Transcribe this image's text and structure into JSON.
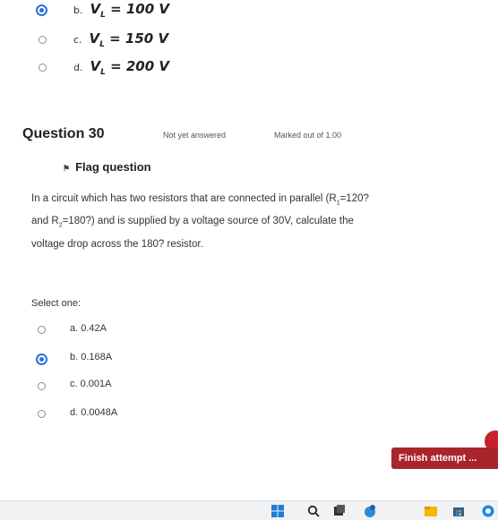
{
  "previous_question": {
    "options": [
      {
        "letter": "b.",
        "var": "V",
        "sub": "L",
        "rest": " = 100 V",
        "selected": true
      },
      {
        "letter": "c.",
        "var": "V",
        "sub": "L",
        "rest": " = 150 V",
        "selected": false
      },
      {
        "letter": "d.",
        "var": "V",
        "sub": "L",
        "rest": " = 200 V",
        "selected": false
      }
    ]
  },
  "question": {
    "title": "Question 30",
    "status": "Not yet answered",
    "marked": "Marked out of 1.00",
    "flag_label": "Flag question",
    "text_line1": "In a circuit which has two resistors that are connected in parallel (R",
    "text_line1_sub": "1",
    "text_line1_end": "=120?",
    "text_line2": "and R",
    "text_line2_sub": "2",
    "text_line2_end": "=180?) and is supplied by a voltage source of 30V, calculate the",
    "text_line3": "voltage drop across the 180? resistor.",
    "select_one": "Select one:",
    "options": [
      {
        "label": "a. 0.42A",
        "selected": false
      },
      {
        "label": "b. 0.168A",
        "selected": true
      },
      {
        "label": "c. 0.001A",
        "selected": false
      },
      {
        "label": "d. 0.0048A",
        "selected": false
      }
    ]
  },
  "finish_button": "Finish attempt ...",
  "taskbar": {
    "icons": [
      "windows-icon",
      "search-icon",
      "task-view-icon",
      "widgets-icon",
      "file-explorer-icon",
      "store-icon",
      "browser-icon"
    ]
  }
}
